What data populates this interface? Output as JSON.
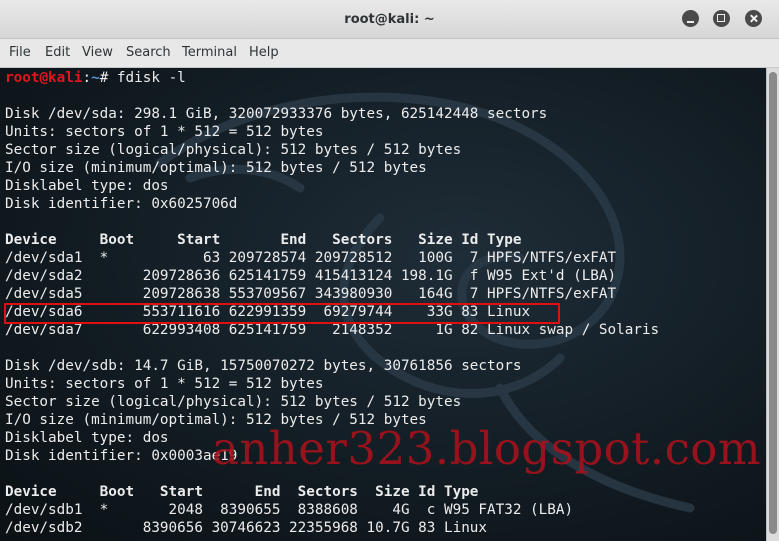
{
  "window": {
    "title": "root@kali: ~"
  },
  "menu": [
    "File",
    "Edit",
    "View",
    "Search",
    "Terminal",
    "Help"
  ],
  "prompt": {
    "user": "root",
    "at": "@",
    "host": "kali",
    "sep": ":",
    "path": "~",
    "symbol": "# ",
    "command": "fdisk -l"
  },
  "lines": [
    {
      "text": "",
      "kind": "text"
    },
    {
      "text": "Disk /dev/sda: 298.1 GiB, 320072933376 bytes, 625142448 sectors",
      "kind": "text"
    },
    {
      "text": "Units: sectors of 1 * 512 = 512 bytes",
      "kind": "text"
    },
    {
      "text": "Sector size (logical/physical): 512 bytes / 512 bytes",
      "kind": "text"
    },
    {
      "text": "I/O size (minimum/optimal): 512 bytes / 512 bytes",
      "kind": "text"
    },
    {
      "text": "Disklabel type: dos",
      "kind": "text"
    },
    {
      "text": "Disk identifier: 0x6025706d",
      "kind": "text"
    },
    {
      "text": "",
      "kind": "text"
    },
    {
      "text": "Device     Boot     Start       End   Sectors   Size Id Type",
      "kind": "header"
    },
    {
      "text": "/dev/sda1  *           63 209728574 209728512   100G  7 HPFS/NTFS/exFAT",
      "kind": "row"
    },
    {
      "text": "/dev/sda2       209728636 625141759 415413124 198.1G  f W95 Ext'd (LBA)",
      "kind": "row"
    },
    {
      "text": "/dev/sda5       209728638 553709567 343980930   164G  7 HPFS/NTFS/exFAT",
      "kind": "row"
    },
    {
      "text": "/dev/sda6       553711616 622991359  69279744    33G 83 Linux",
      "kind": "row"
    },
    {
      "text": "/dev/sda7       622993408 625141759   2148352     1G 82 Linux swap / Solaris",
      "kind": "row"
    },
    {
      "text": "",
      "kind": "text"
    },
    {
      "text": "Disk /dev/sdb: 14.7 GiB, 15750070272 bytes, 30761856 sectors",
      "kind": "text"
    },
    {
      "text": "Units: sectors of 1 * 512 = 512 bytes",
      "kind": "text"
    },
    {
      "text": "Sector size (logical/physical): 512 bytes / 512 bytes",
      "kind": "text"
    },
    {
      "text": "I/O size (minimum/optimal): 512 bytes / 512 bytes",
      "kind": "text"
    },
    {
      "text": "Disklabel type: dos",
      "kind": "text"
    },
    {
      "text": "Disk identifier: 0x0003ae19",
      "kind": "text"
    },
    {
      "text": "",
      "kind": "text"
    },
    {
      "text": "Device     Boot   Start      End  Sectors  Size Id Type",
      "kind": "header"
    },
    {
      "text": "/dev/sdb1  *       2048  8390655  8388608    4G  c W95 FAT32 (LBA)",
      "kind": "row"
    },
    {
      "text": "/dev/sdb2       8390656 30746623 22355968 10.7G 83 Linux",
      "kind": "row"
    }
  ],
  "watermark": "anher323.blogspot.com",
  "colors": {
    "prompt_red": "#e0161c",
    "path_blue": "#5a8fd8",
    "highlight_box": "#e01010",
    "terminal_bg": "#121c23"
  }
}
